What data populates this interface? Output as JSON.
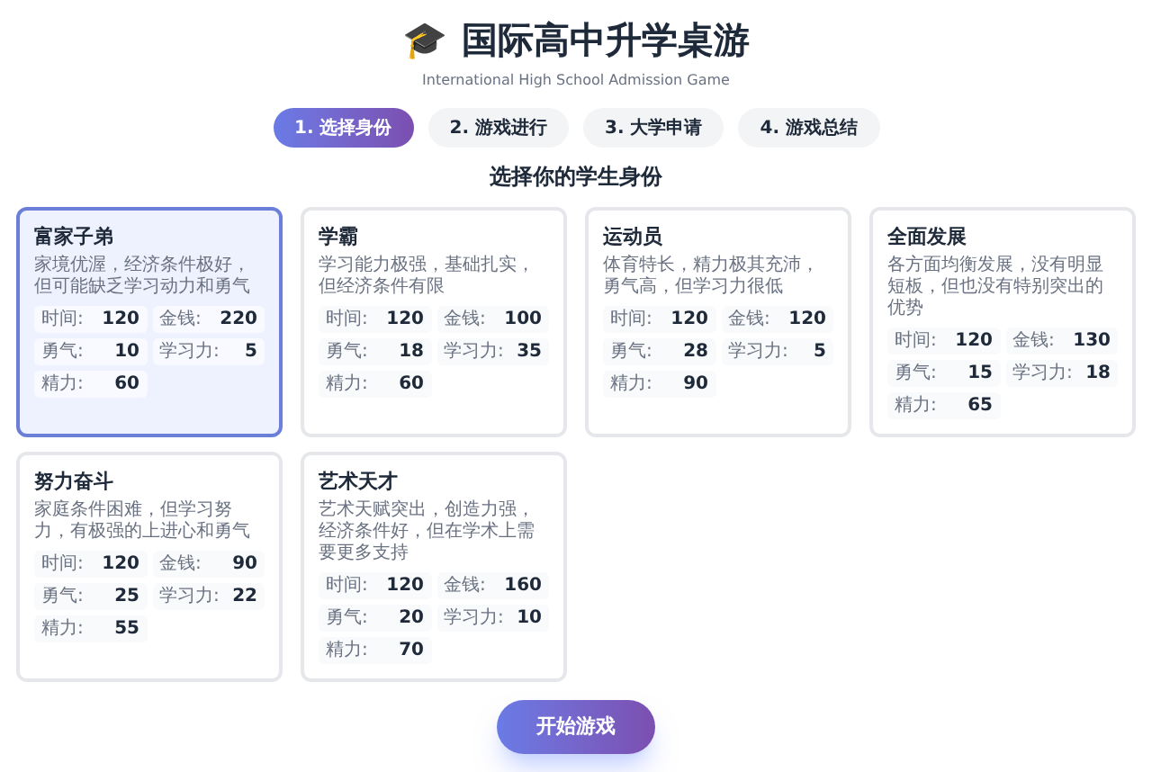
{
  "header": {
    "icon": "🎓",
    "title": "国际高中升学桌游",
    "subtitle": "International High School Admission Game"
  },
  "steps": [
    {
      "label": "1. 选择身份",
      "selected": true
    },
    {
      "label": "2. 游戏进行",
      "selected": false
    },
    {
      "label": "3. 大学申请",
      "selected": false
    },
    {
      "label": "4. 游戏总结",
      "selected": false
    }
  ],
  "section_title": "选择你的学生身份",
  "identities": [
    {
      "name": "富家子弟",
      "description": "家境优渥，经济条件极好，但可能缺乏学习动力和勇气",
      "selected": true,
      "stats": [
        {
          "label": "时间:",
          "value": "120"
        },
        {
          "label": "金钱:",
          "value": "220"
        },
        {
          "label": "勇气:",
          "value": "10"
        },
        {
          "label": "学习力:",
          "value": "5"
        },
        {
          "label": "精力:",
          "value": "60"
        }
      ]
    },
    {
      "name": "学霸",
      "description": "学习能力极强，基础扎实，但经济条件有限",
      "selected": false,
      "stats": [
        {
          "label": "时间:",
          "value": "120"
        },
        {
          "label": "金钱:",
          "value": "100"
        },
        {
          "label": "勇气:",
          "value": "18"
        },
        {
          "label": "学习力:",
          "value": "35"
        },
        {
          "label": "精力:",
          "value": "60"
        }
      ]
    },
    {
      "name": "运动员",
      "description": "体育特长，精力极其充沛，勇气高，但学习力很低",
      "selected": false,
      "stats": [
        {
          "label": "时间:",
          "value": "120"
        },
        {
          "label": "金钱:",
          "value": "120"
        },
        {
          "label": "勇气:",
          "value": "28"
        },
        {
          "label": "学习力:",
          "value": "5"
        },
        {
          "label": "精力:",
          "value": "90"
        }
      ]
    },
    {
      "name": "全面发展",
      "description": "各方面均衡发展，没有明显短板，但也没有特别突出的优势",
      "selected": false,
      "stats": [
        {
          "label": "时间:",
          "value": "120"
        },
        {
          "label": "金钱:",
          "value": "130"
        },
        {
          "label": "勇气:",
          "value": "15"
        },
        {
          "label": "学习力:",
          "value": "18"
        },
        {
          "label": "精力:",
          "value": "65"
        }
      ]
    },
    {
      "name": "努力奋斗",
      "description": "家庭条件困难，但学习努力，有极强的上进心和勇气",
      "selected": false,
      "stats": [
        {
          "label": "时间:",
          "value": "120"
        },
        {
          "label": "金钱:",
          "value": "90"
        },
        {
          "label": "勇气:",
          "value": "25"
        },
        {
          "label": "学习力:",
          "value": "22"
        },
        {
          "label": "精力:",
          "value": "55"
        }
      ]
    },
    {
      "name": "艺术天才",
      "description": "艺术天赋突出，创造力强，经济条件好，但在学术上需要更多支持",
      "selected": false,
      "stats": [
        {
          "label": "时间:",
          "value": "120"
        },
        {
          "label": "金钱:",
          "value": "160"
        },
        {
          "label": "勇气:",
          "value": "20"
        },
        {
          "label": "学习力:",
          "value": "10"
        },
        {
          "label": "精力:",
          "value": "70"
        }
      ]
    }
  ],
  "start_button": "开始游戏"
}
